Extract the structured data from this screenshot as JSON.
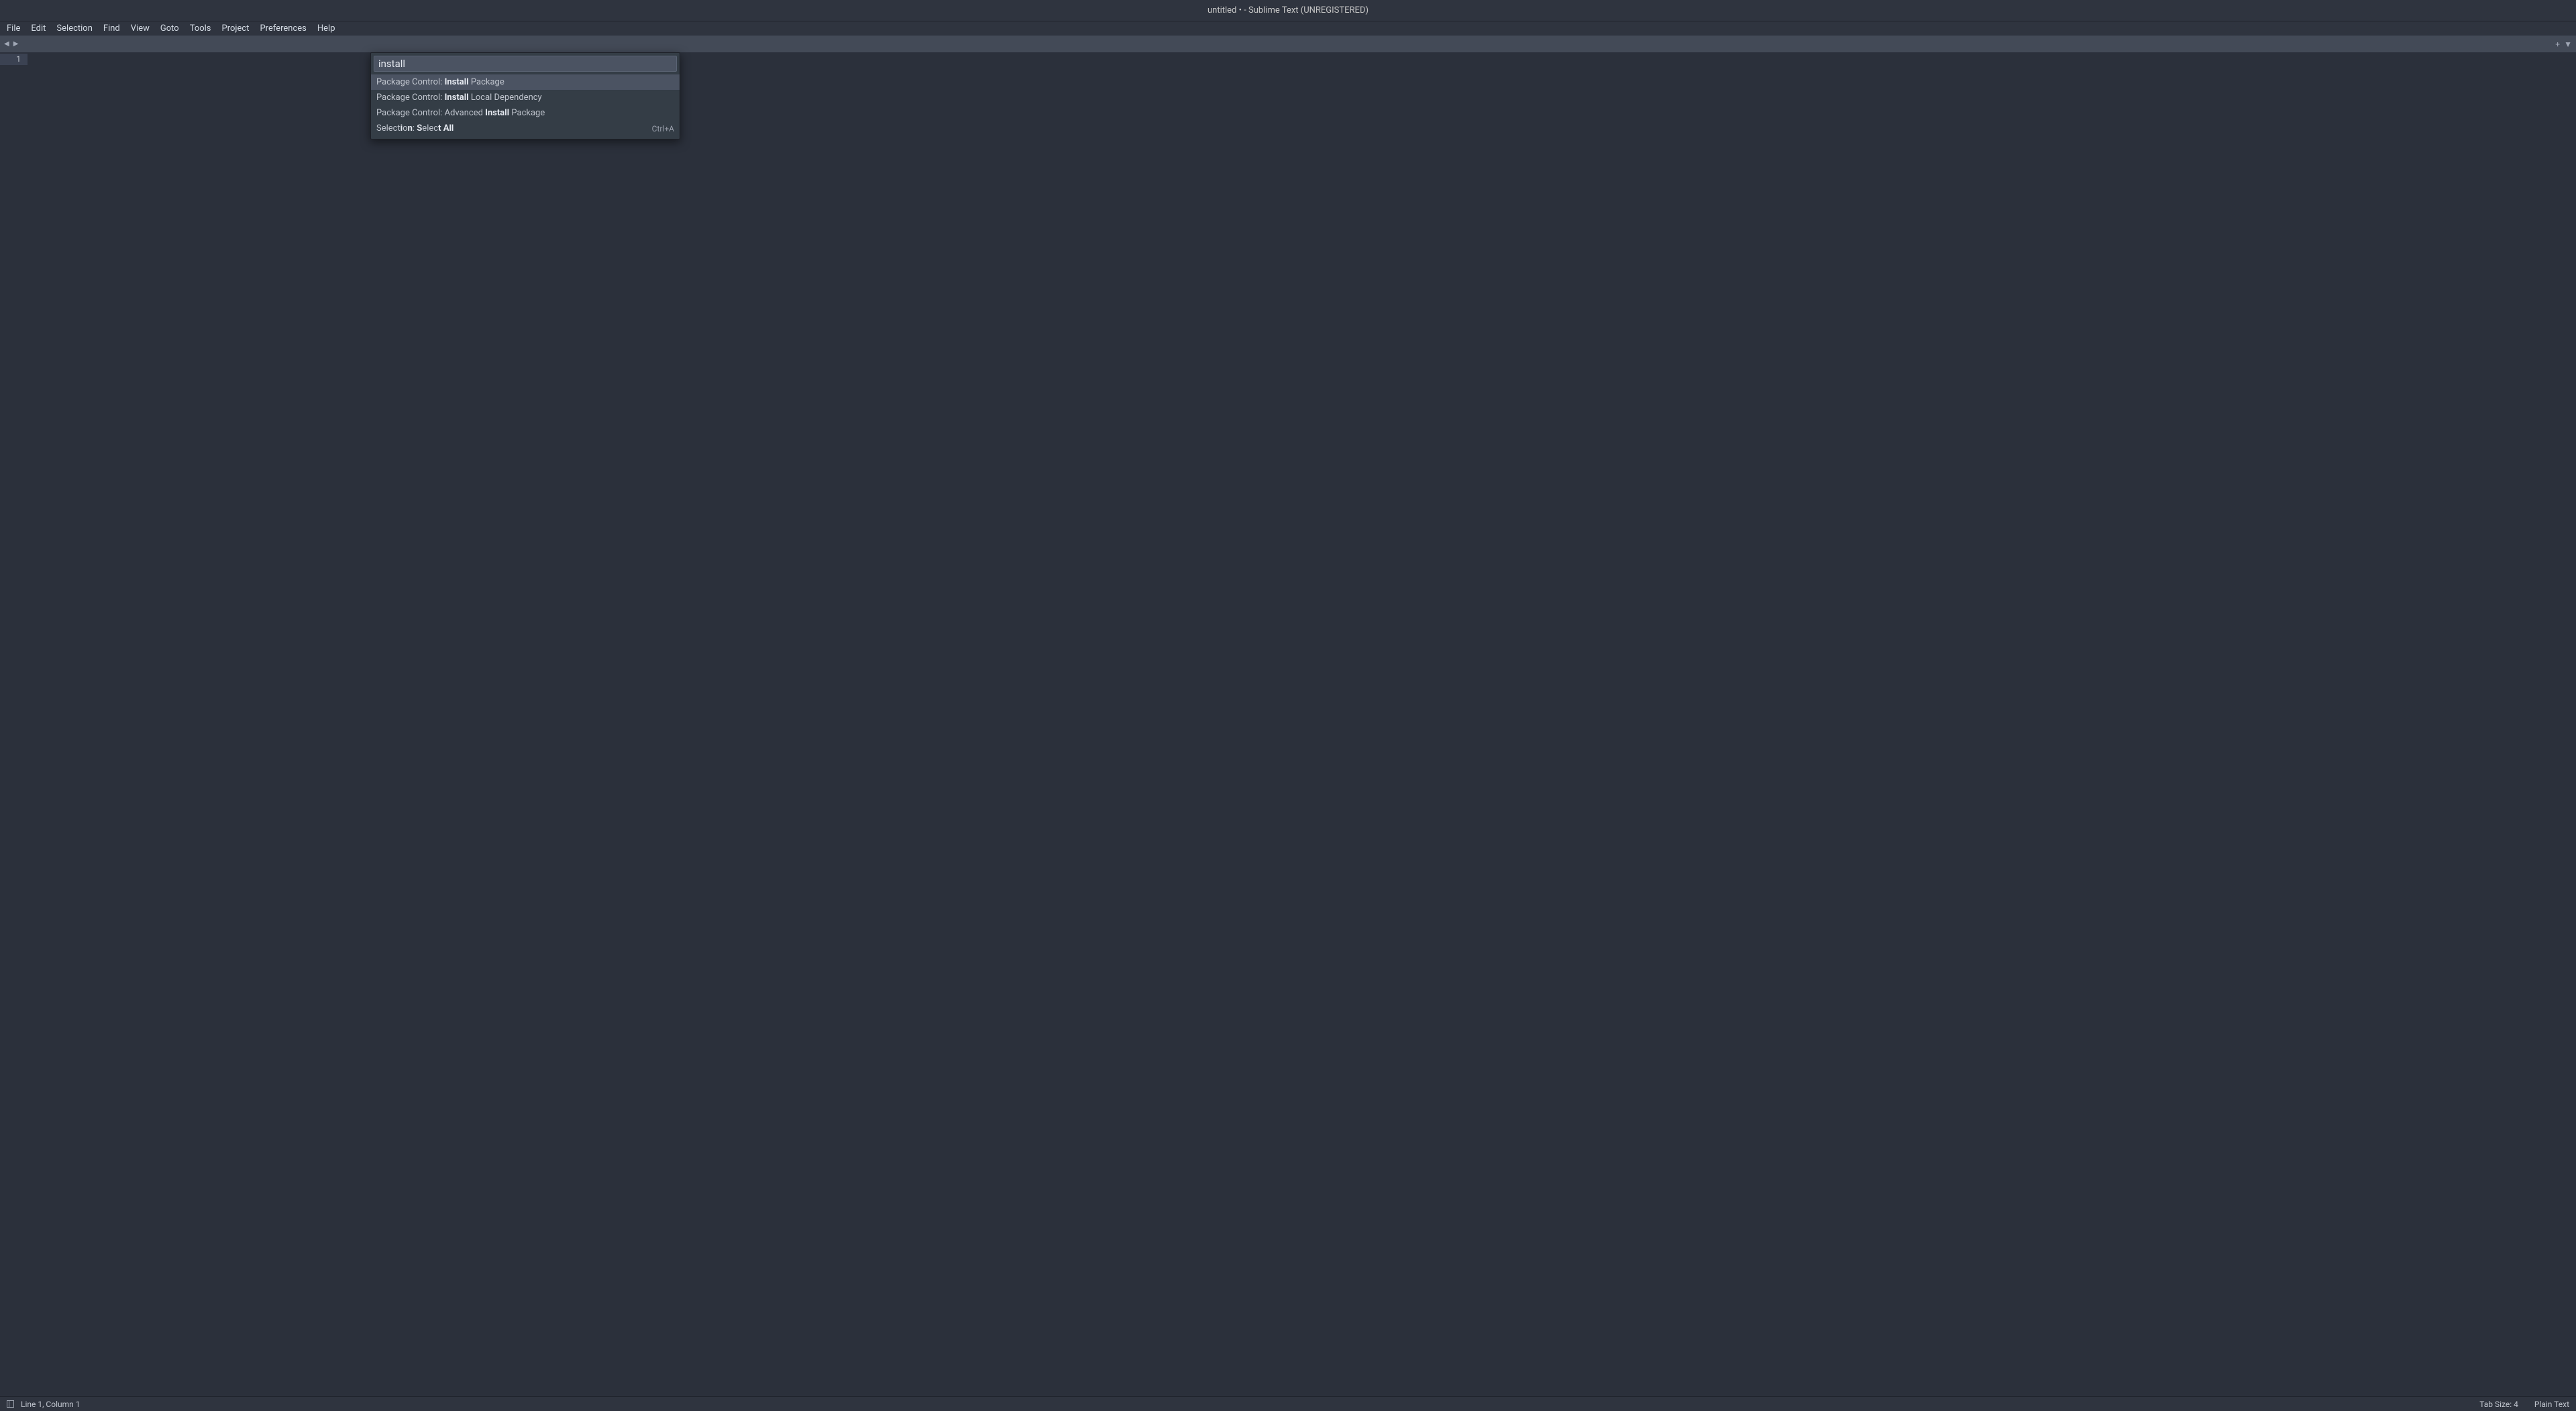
{
  "window": {
    "title": "untitled • - Sublime Text (UNREGISTERED)"
  },
  "menubar": {
    "items": [
      "File",
      "Edit",
      "Selection",
      "Find",
      "View",
      "Goto",
      "Tools",
      "Project",
      "Preferences",
      "Help"
    ]
  },
  "tabbar": {
    "nav_back": "◀",
    "nav_forward": "▶",
    "add": "+",
    "dropdown": "▼"
  },
  "gutter": {
    "lines": [
      "1"
    ]
  },
  "command_palette": {
    "query": "install",
    "items": [
      {
        "segments": [
          {
            "t": "Package Control: ",
            "hl": false
          },
          {
            "t": "Install",
            "hl": true
          },
          {
            "t": " Package",
            "hl": false
          }
        ],
        "shortcut": "",
        "selected": true
      },
      {
        "segments": [
          {
            "t": "Package Control: ",
            "hl": false
          },
          {
            "t": "Install",
            "hl": true
          },
          {
            "t": " Local Dependency",
            "hl": false
          }
        ],
        "shortcut": "",
        "selected": false
      },
      {
        "segments": [
          {
            "t": "Package Control: Advanced ",
            "hl": false
          },
          {
            "t": "Install",
            "hl": true
          },
          {
            "t": " Package",
            "hl": false
          }
        ],
        "shortcut": "",
        "selected": false
      },
      {
        "segments": [
          {
            "t": "Select",
            "hl": false
          },
          {
            "t": "i",
            "hl": true
          },
          {
            "t": "o",
            "hl": false
          },
          {
            "t": "n",
            "hl": true
          },
          {
            "t": ": ",
            "hl": false
          },
          {
            "t": "S",
            "hl": true
          },
          {
            "t": "elec",
            "hl": false
          },
          {
            "t": "t",
            "hl": true
          },
          {
            "t": " ",
            "hl": false
          },
          {
            "t": "All",
            "hl": true
          }
        ],
        "shortcut": "Ctrl+A",
        "selected": false
      }
    ]
  },
  "statusbar": {
    "position": "Line 1, Column 1",
    "tabsize": "Tab Size: 4",
    "syntax": "Plain Text"
  }
}
